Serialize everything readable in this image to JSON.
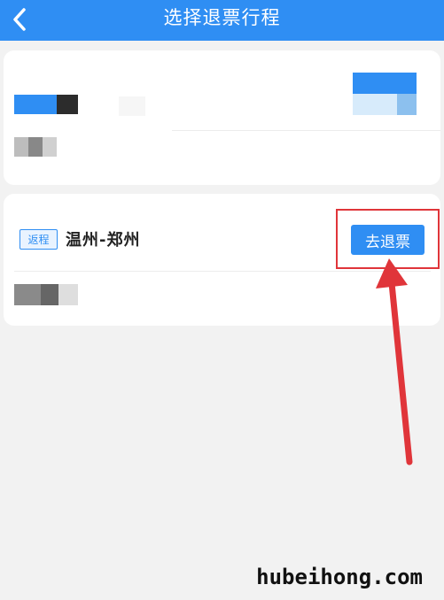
{
  "header": {
    "title": "选择退票行程",
    "background_color": "#2f8ef3",
    "back_icon": "chevron-left-icon"
  },
  "trip_card_2": {
    "badge_label": "返程",
    "route": "温州-郑州",
    "refund_button_label": "去退票"
  },
  "watermark": "hubeihong.com",
  "colors": {
    "accent": "#2f8ef3",
    "highlight": "#e0353a",
    "background": "#f2f2f2"
  }
}
